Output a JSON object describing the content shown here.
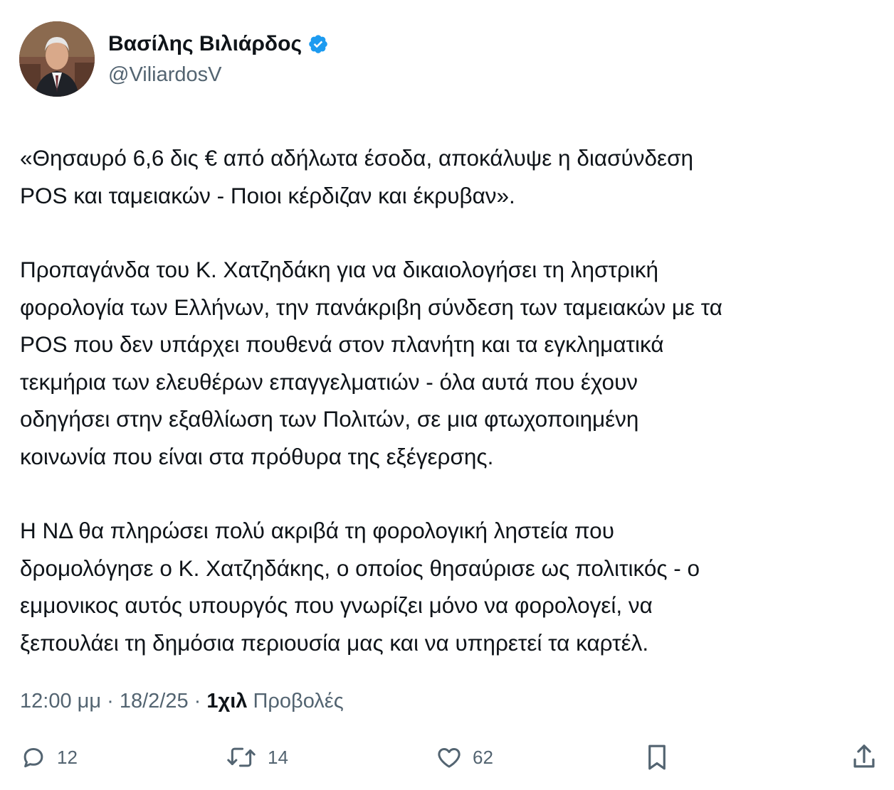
{
  "author": {
    "name": "Βασίλης Βιλιάρδος",
    "handle": "@ViliardosV",
    "verified_color": "#1d9bf0"
  },
  "tweet": {
    "p1": [
      "«Θησαυρό 6,6 δις € από αδήλωτα έσοδα, αποκάλυψε η διασύνδεση",
      "POS και ταμειακών - Ποιοι κέρδιζαν και έκρυβαν»."
    ],
    "p2": [
      "Προπαγάνδα του Κ. Χατζηδάκη για να δικαιολογήσει τη ληστρική",
      "φορολογία των Ελλήνων, την πανάκριβη σύνδεση των ταμειακών με τα",
      "POS που δεν υπάρχει πουθενά στον πλανήτη και τα εγκληματικά",
      "τεκμήρια των ελευθέρων επαγγελματιών - όλα αυτά που έχουν",
      "οδηγήσει στην εξαθλίωση των Πολιτών, σε μια φτωχοποιημένη",
      "κοινωνία που είναι στα πρόθυρα της εξέγερσης."
    ],
    "p3": [
      "Η ΝΔ θα πληρώσει πολύ ακριβά τη φορολογική ληστεία που",
      "δρομολόγησε ο Κ. Χατζηδάκης, ο οποίος θησαύρισε ως πολιτικός - ο",
      "εμμονικος αυτός υπουργός που γνωρίζει μόνο να φορολογεί, να",
      "ξεπουλάει τη δημόσια περιουσία μας και να υπηρετεί τα καρτέλ."
    ]
  },
  "meta": {
    "time": "12:00 μμ",
    "sep": "·",
    "date": "18/2/25",
    "views_count": "1χιλ",
    "views_label": "Προβολές"
  },
  "actions": {
    "replies": "12",
    "reposts": "14",
    "likes": "62"
  },
  "icons": [
    "verified-badge-icon",
    "reply-icon",
    "repost-icon",
    "like-icon",
    "bookmark-icon",
    "share-icon"
  ]
}
